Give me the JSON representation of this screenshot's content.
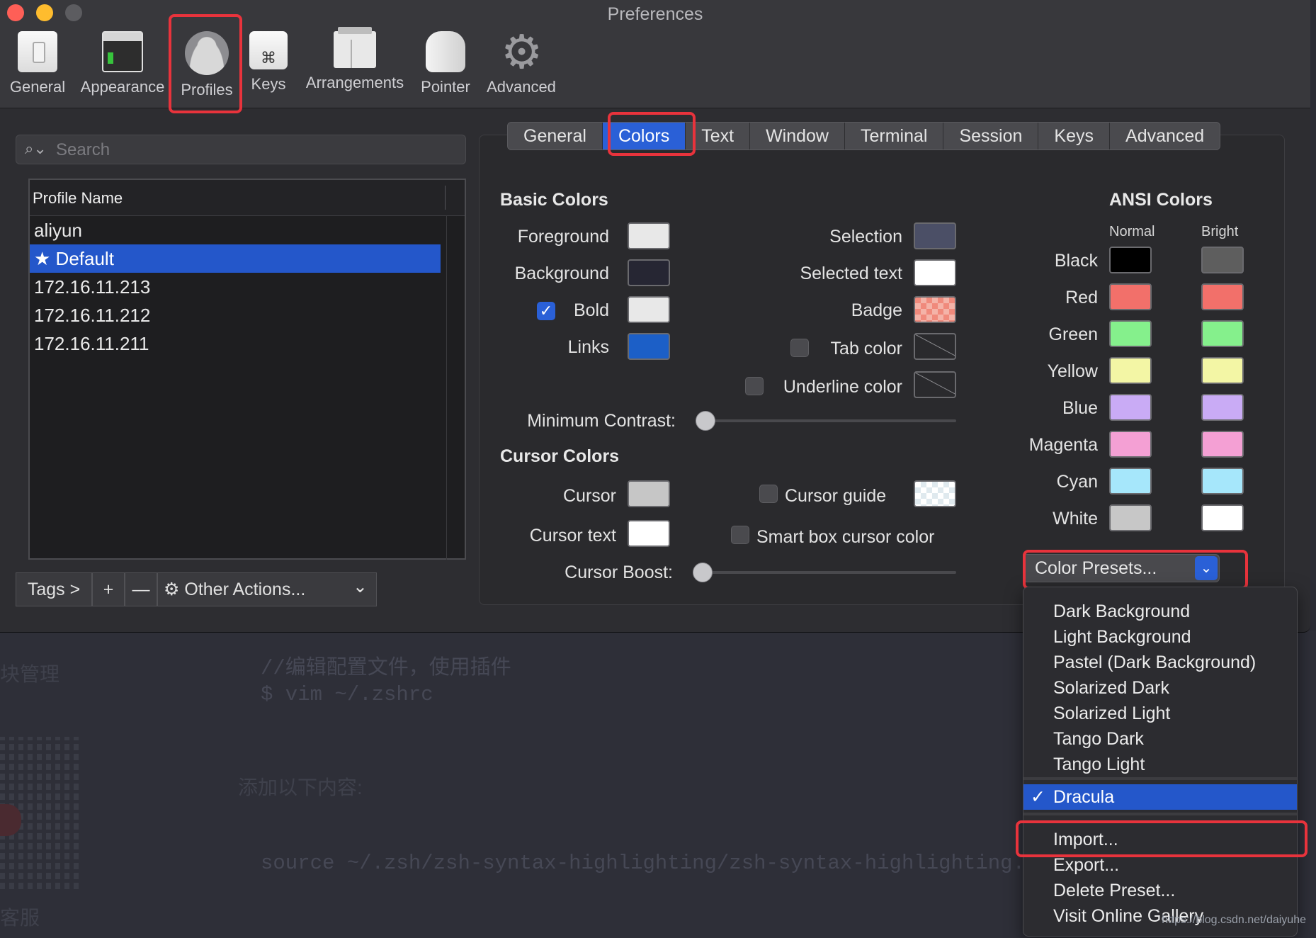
{
  "window": {
    "title": "Preferences"
  },
  "toolbar": {
    "general": "General",
    "appearance": "Appearance",
    "profiles": "Profiles",
    "keys": "Keys",
    "arrangements": "Arrangements",
    "pointer": "Pointer",
    "advanced": "Advanced",
    "keys_glyph": "⌘",
    "advanced_glyph": "⚙"
  },
  "search": {
    "placeholder": "Search",
    "icon": "⌕⌄"
  },
  "profiles": {
    "header": "Profile Name",
    "items": [
      "aliyun",
      "Default",
      "172.16.11.213",
      "172.16.11.212",
      "172.16.11.211"
    ],
    "default_star": "★"
  },
  "bottom_bar": {
    "tags": "Tags >",
    "add": "+",
    "remove": "—",
    "gear": "⚙",
    "other_actions": "Other Actions...",
    "chevron": "⌄"
  },
  "tabs": [
    "General",
    "Colors",
    "Text",
    "Window",
    "Terminal",
    "Session",
    "Keys",
    "Advanced"
  ],
  "basic": {
    "title": "Basic Colors",
    "foreground": "Foreground",
    "background": "Background",
    "bold": "Bold",
    "links": "Links",
    "selection": "Selection",
    "selected_text": "Selected text",
    "badge": "Badge",
    "tab_color": "Tab color",
    "underline_color": "Underline color",
    "min_contrast": "Minimum Contrast:",
    "bold_check": "✓",
    "colors": {
      "foreground": "#e8e8e8",
      "background": "#262633",
      "bold": "#e8e8e8",
      "links": "#1c5fc7",
      "selection": "#4b4f66",
      "selected_text": "#ffffff"
    }
  },
  "cursor": {
    "title": "Cursor Colors",
    "cursor": "Cursor",
    "cursor_text": "Cursor text",
    "cursor_guide": "Cursor guide",
    "smart_box": "Smart box cursor color",
    "boost": "Cursor Boost:",
    "colors": {
      "cursor": "#c6c6c6",
      "cursor_text": "#ffffff"
    }
  },
  "ansi": {
    "title": "ANSI Colors",
    "normal": "Normal",
    "bright": "Bright",
    "rows": [
      {
        "name": "Black",
        "normal": "#000000",
        "bright": "#5e5e5e"
      },
      {
        "name": "Red",
        "normal": "#f2706a",
        "bright": "#f2706a"
      },
      {
        "name": "Green",
        "normal": "#85f08c",
        "bright": "#85f08c"
      },
      {
        "name": "Yellow",
        "normal": "#f3f6a5",
        "bright": "#f3f6a5"
      },
      {
        "name": "Blue",
        "normal": "#c9abf5",
        "bright": "#c9abf5"
      },
      {
        "name": "Magenta",
        "normal": "#f4a0d4",
        "bright": "#f4a0d4"
      },
      {
        "name": "Cyan",
        "normal": "#a6e7fb",
        "bright": "#a6e7fb"
      },
      {
        "name": "White",
        "normal": "#c7c7c7",
        "bright": "#ffffff"
      }
    ]
  },
  "presets": {
    "button": "Color Presets...",
    "arrow": "⌄",
    "items": [
      "Dark Background",
      "Light Background",
      "Pastel (Dark Background)",
      "Solarized Dark",
      "Solarized Light",
      "Tango Dark",
      "Tango Light"
    ],
    "selected": "Dracula",
    "selected_check": "✓",
    "actions": [
      "Import...",
      "Export...",
      "Delete Preset...",
      "Visit Online Gallery"
    ]
  },
  "background_page": {
    "side_top": "块管理",
    "comment": "//编辑配置文件，使用插件",
    "cmd": "$ vim ~/.zshrc",
    "heading": "添加以下内容:",
    "source": "source ~/.zsh/zsh-syntax-highlighting/zsh-syntax-highlighting.zsh",
    "side_bottom": "客服",
    "watermark": "https://blog.csdn.net/daiyuhe"
  }
}
